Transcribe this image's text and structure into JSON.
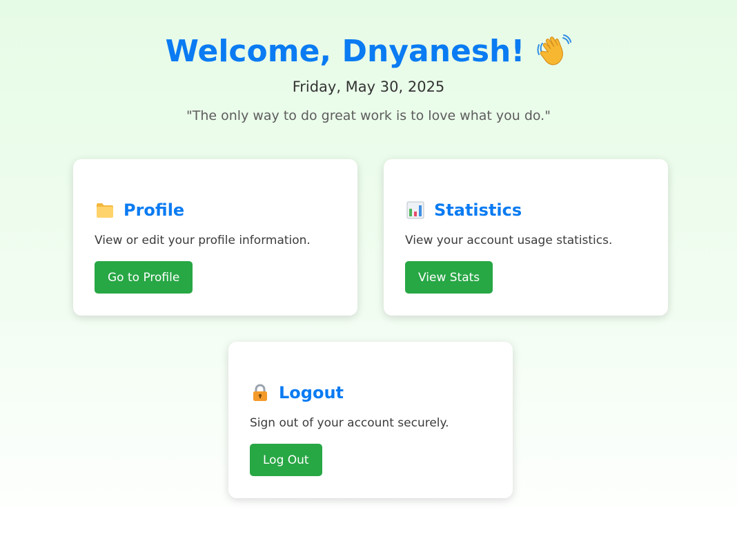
{
  "header": {
    "title": "Welcome, Dnyanesh!",
    "title_icon": "waving-hand-icon",
    "date": "Friday, May 30, 2025",
    "quote": "\"The only way to do great work is to love what you do.\""
  },
  "colors": {
    "accent": "#0a7bf2",
    "button": "#28a745",
    "background_top": "#e6fbe6"
  },
  "cards": {
    "profile": {
      "icon": "folder-icon",
      "title": "Profile",
      "description": "View or edit your profile information.",
      "button_label": "Go to Profile"
    },
    "stats": {
      "icon": "bar-chart-icon",
      "title": "Statistics",
      "description": "View your account usage statistics.",
      "button_label": "View Stats"
    },
    "logout": {
      "icon": "lock-icon",
      "title": "Logout",
      "description": "Sign out of your account securely.",
      "button_label": "Log Out"
    }
  }
}
